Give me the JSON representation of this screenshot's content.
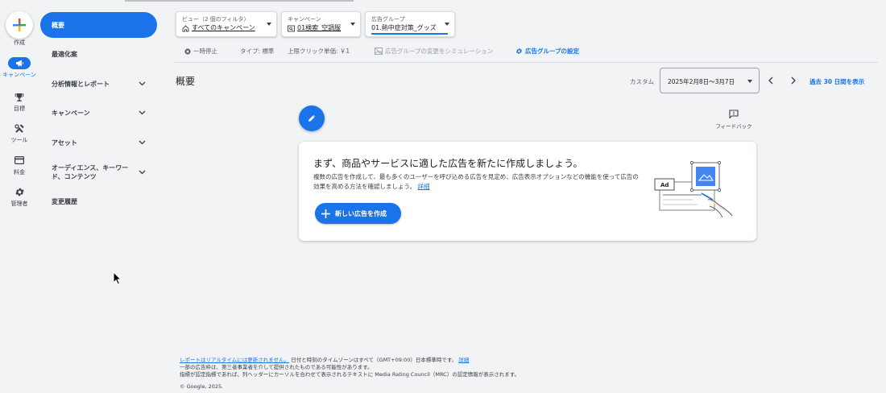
{
  "rail": {
    "create_label": "作成",
    "items": [
      {
        "label": "キャンペーン",
        "icon": "megaphone-icon",
        "active": true
      },
      {
        "label": "目標",
        "icon": "trophy-icon"
      },
      {
        "label": "ツール",
        "icon": "tools-icon"
      },
      {
        "label": "料金",
        "icon": "credit-card-icon"
      },
      {
        "label": "管理者",
        "icon": "gear-icon"
      }
    ]
  },
  "sidebar": {
    "items": [
      {
        "label": "概要",
        "active": true
      },
      {
        "label": "最適化案"
      },
      {
        "label": "分析情報とレポート",
        "expandable": true
      },
      {
        "label": "キャンペーン",
        "expandable": true
      },
      {
        "label": "アセット",
        "expandable": true
      },
      {
        "label": "オーディエンス、キーワード、コンテンツ",
        "expandable": true
      },
      {
        "label": "変更履歴"
      }
    ]
  },
  "filters": {
    "view": {
      "label": "ビュー（2 個のフィルタ）",
      "value": "すべてのキャンペーン"
    },
    "campaign": {
      "label": "キャンペーン",
      "value": "01検索_空調服"
    },
    "adgroup": {
      "label": "広告グループ",
      "value": "01.熱中症対策_グッズ"
    }
  },
  "info_row": {
    "status": "一時停止",
    "type": "タイプ: 標準",
    "max_cpc": "上限クリック単価: ￥1",
    "simulate": "広告グループの変更をシミュレーション",
    "settings": "広告グループの設定"
  },
  "page_title": "概要",
  "date": {
    "label": "カスタム",
    "range": "2025年2月8日〜3月7日",
    "last30": "過去 30 日間を表示"
  },
  "feedback_label": "フィードバック",
  "card": {
    "title": "まず、商品やサービスに適した広告を新たに作成しましょう。",
    "description": "複数の広告を作成して、最も多くのユーザーを呼び込める広告を見定め、広告表示オプションなどの機能を使って広告の効果を高める方法を確認しましょう。",
    "details_link": "詳細",
    "button": "新しい広告を作成",
    "illustration_badge": "Ad"
  },
  "footer": {
    "realtime_link": "レポートはリアルタイムには更新されません。",
    "timezone": "日付と時刻のタイムゾーンはすべて（GMT+09:00）日本標準時です。",
    "details_link": "詳細",
    "line2": "一部の広告枠は、第三者事業者を介して提供されたものである可能性があります。",
    "line3": "指標が認定指標であれば、列ヘッダーにカーソルを合わせて表示されるテキストに Media Rating Council（MRC）の認定情報が表示されます。",
    "copyright": "© Google, 2025."
  },
  "colors": {
    "accent": "#1a73e8",
    "background": "#f1f3f4"
  }
}
